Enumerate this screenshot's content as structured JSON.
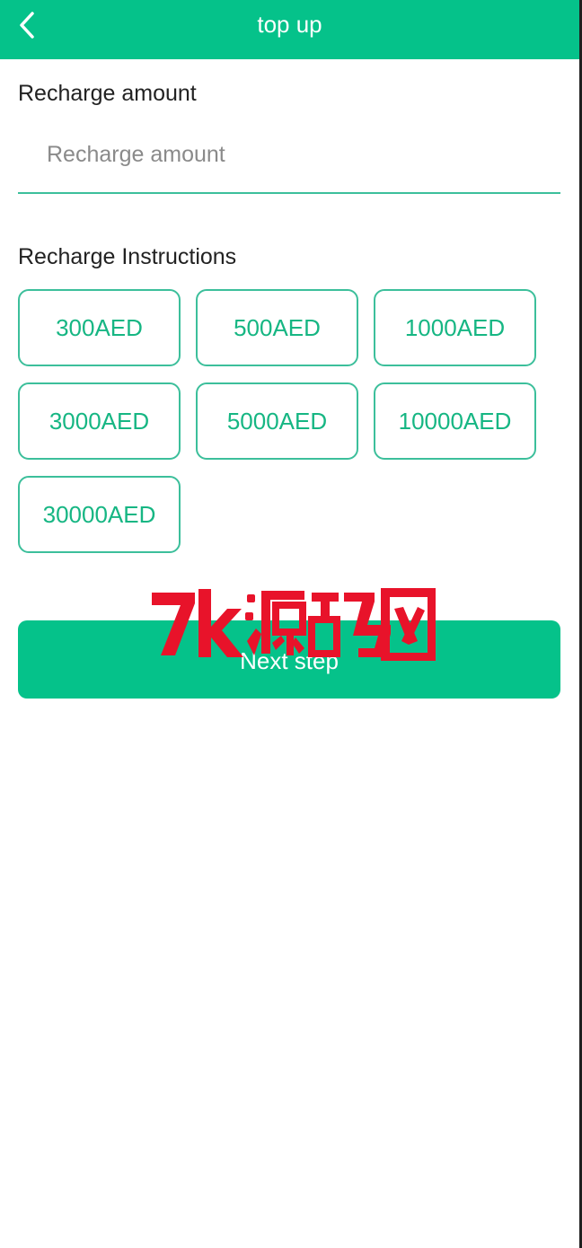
{
  "header": {
    "title": "top up",
    "back_icon": "chevron-left-icon"
  },
  "form": {
    "amount_label": "Recharge amount",
    "amount_placeholder": "Recharge amount",
    "amount_value": ""
  },
  "instructions": {
    "label": "Recharge Instructions",
    "amounts": [
      "300AED",
      "500AED",
      "1000AED",
      "3000AED",
      "5000AED",
      "10000AED",
      "30000AED"
    ]
  },
  "actions": {
    "next_label": "Next step"
  },
  "watermark": {
    "text": "7k源码网"
  },
  "colors": {
    "brand": "#05c28a",
    "accent_text": "#16b683",
    "border": "#3cbf9b",
    "watermark": "#e8132a"
  }
}
